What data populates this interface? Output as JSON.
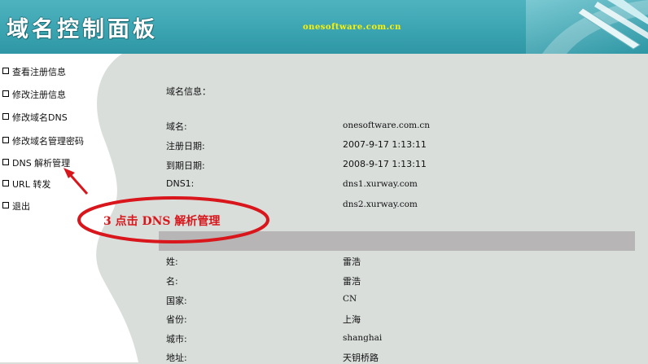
{
  "header": {
    "title": "域名控制面板",
    "site": "onesoftware.com.cn"
  },
  "sidebar": {
    "items": [
      {
        "label": "查看注册信息"
      },
      {
        "label": "修改注册信息"
      },
      {
        "label": "修改域名DNS"
      },
      {
        "label": "修改域名管理密码"
      },
      {
        "label": "DNS 解析管理"
      },
      {
        "label": "URL 转发"
      },
      {
        "label": "退出"
      }
    ]
  },
  "domain_info": {
    "heading": "域名信息：",
    "rows": [
      {
        "label": "域名:",
        "value": "onesoftware.com.cn"
      },
      {
        "label": "注册日期:",
        "value": "2007-9-17 1:13:11"
      },
      {
        "label": "到期日期:",
        "value": "2008-9-17 1:13:11"
      },
      {
        "label": "DNS1:",
        "value": "dns1.xurway.com"
      },
      {
        "label": "",
        "value": "dns2.xurway.com"
      }
    ]
  },
  "registrant": {
    "rows": [
      {
        "label": "姓:",
        "value": "雷浩"
      },
      {
        "label": "名:",
        "value": "雷浩"
      },
      {
        "label": "国家:",
        "value": "CN"
      },
      {
        "label": "省份:",
        "value": "上海"
      },
      {
        "label": "城市:",
        "value": "shanghai"
      },
      {
        "label": "地址:",
        "value": "天钥桥路"
      }
    ]
  },
  "annotation": {
    "text": "3  点击 DNS 解析管理"
  },
  "colors": {
    "header": "#3aa3b0",
    "site_text": "#fff200",
    "page_bg": "#d9dedb",
    "section_bar": "#b7b5b5",
    "annotation": "#d8161b"
  }
}
